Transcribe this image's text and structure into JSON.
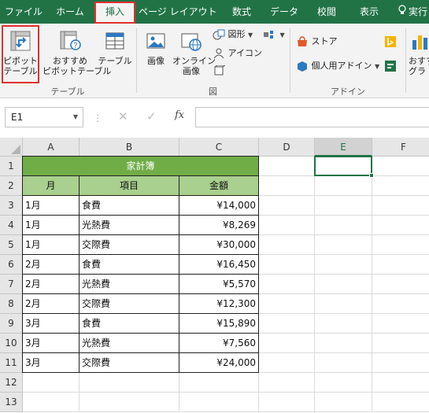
{
  "tabs": [
    "ファイル",
    "ホーム",
    "挿入",
    "ページ レイアウト",
    "数式",
    "データ",
    "校閲",
    "表示",
    "実行"
  ],
  "active_tab": "挿入",
  "ribbon": {
    "pivot": {
      "line1": "ピボット",
      "line2": "テーブル"
    },
    "recommended_pivot": {
      "line1": "おすすめ",
      "line2": "ピボットテーブル"
    },
    "table": "テーブル",
    "picture": "画像",
    "online_picture": {
      "line1": "オンライン",
      "line2": "画像"
    },
    "shapes": "図形",
    "icons": "アイコン",
    "store": "ストア",
    "my_addins": "個人用アドイン",
    "recommended_charts": {
      "line1": "おすす",
      "line2": "グラ"
    },
    "groups": {
      "tables": "テーブル",
      "illustrations": "図",
      "addins": "アドイン"
    }
  },
  "formula_bar": {
    "name_box": "E1",
    "fx": "fx",
    "value": ""
  },
  "columns": [
    "A",
    "B",
    "C",
    "D",
    "E",
    "F"
  ],
  "selected_column": "E",
  "rows": [
    "1",
    "2",
    "3",
    "4",
    "5",
    "6",
    "7",
    "8",
    "9",
    "10",
    "11",
    "12",
    "13"
  ],
  "sheet": {
    "title": "家計簿",
    "headers": [
      "月",
      "項目",
      "金額"
    ],
    "data": [
      [
        "1月",
        "食費",
        "¥14,000"
      ],
      [
        "1月",
        "光熱費",
        "¥8,269"
      ],
      [
        "1月",
        "交際費",
        "¥30,000"
      ],
      [
        "2月",
        "食費",
        "¥16,450"
      ],
      [
        "2月",
        "光熱費",
        "¥5,570"
      ],
      [
        "2月",
        "交際費",
        "¥12,300"
      ],
      [
        "3月",
        "食費",
        "¥15,890"
      ],
      [
        "3月",
        "光熱費",
        "¥7,560"
      ],
      [
        "3月",
        "交際費",
        "¥24,000"
      ]
    ]
  },
  "colors": {
    "excel_green": "#217346",
    "title_fill": "#70ad47",
    "header_fill": "#a9d08e",
    "highlight": "#e03030"
  }
}
